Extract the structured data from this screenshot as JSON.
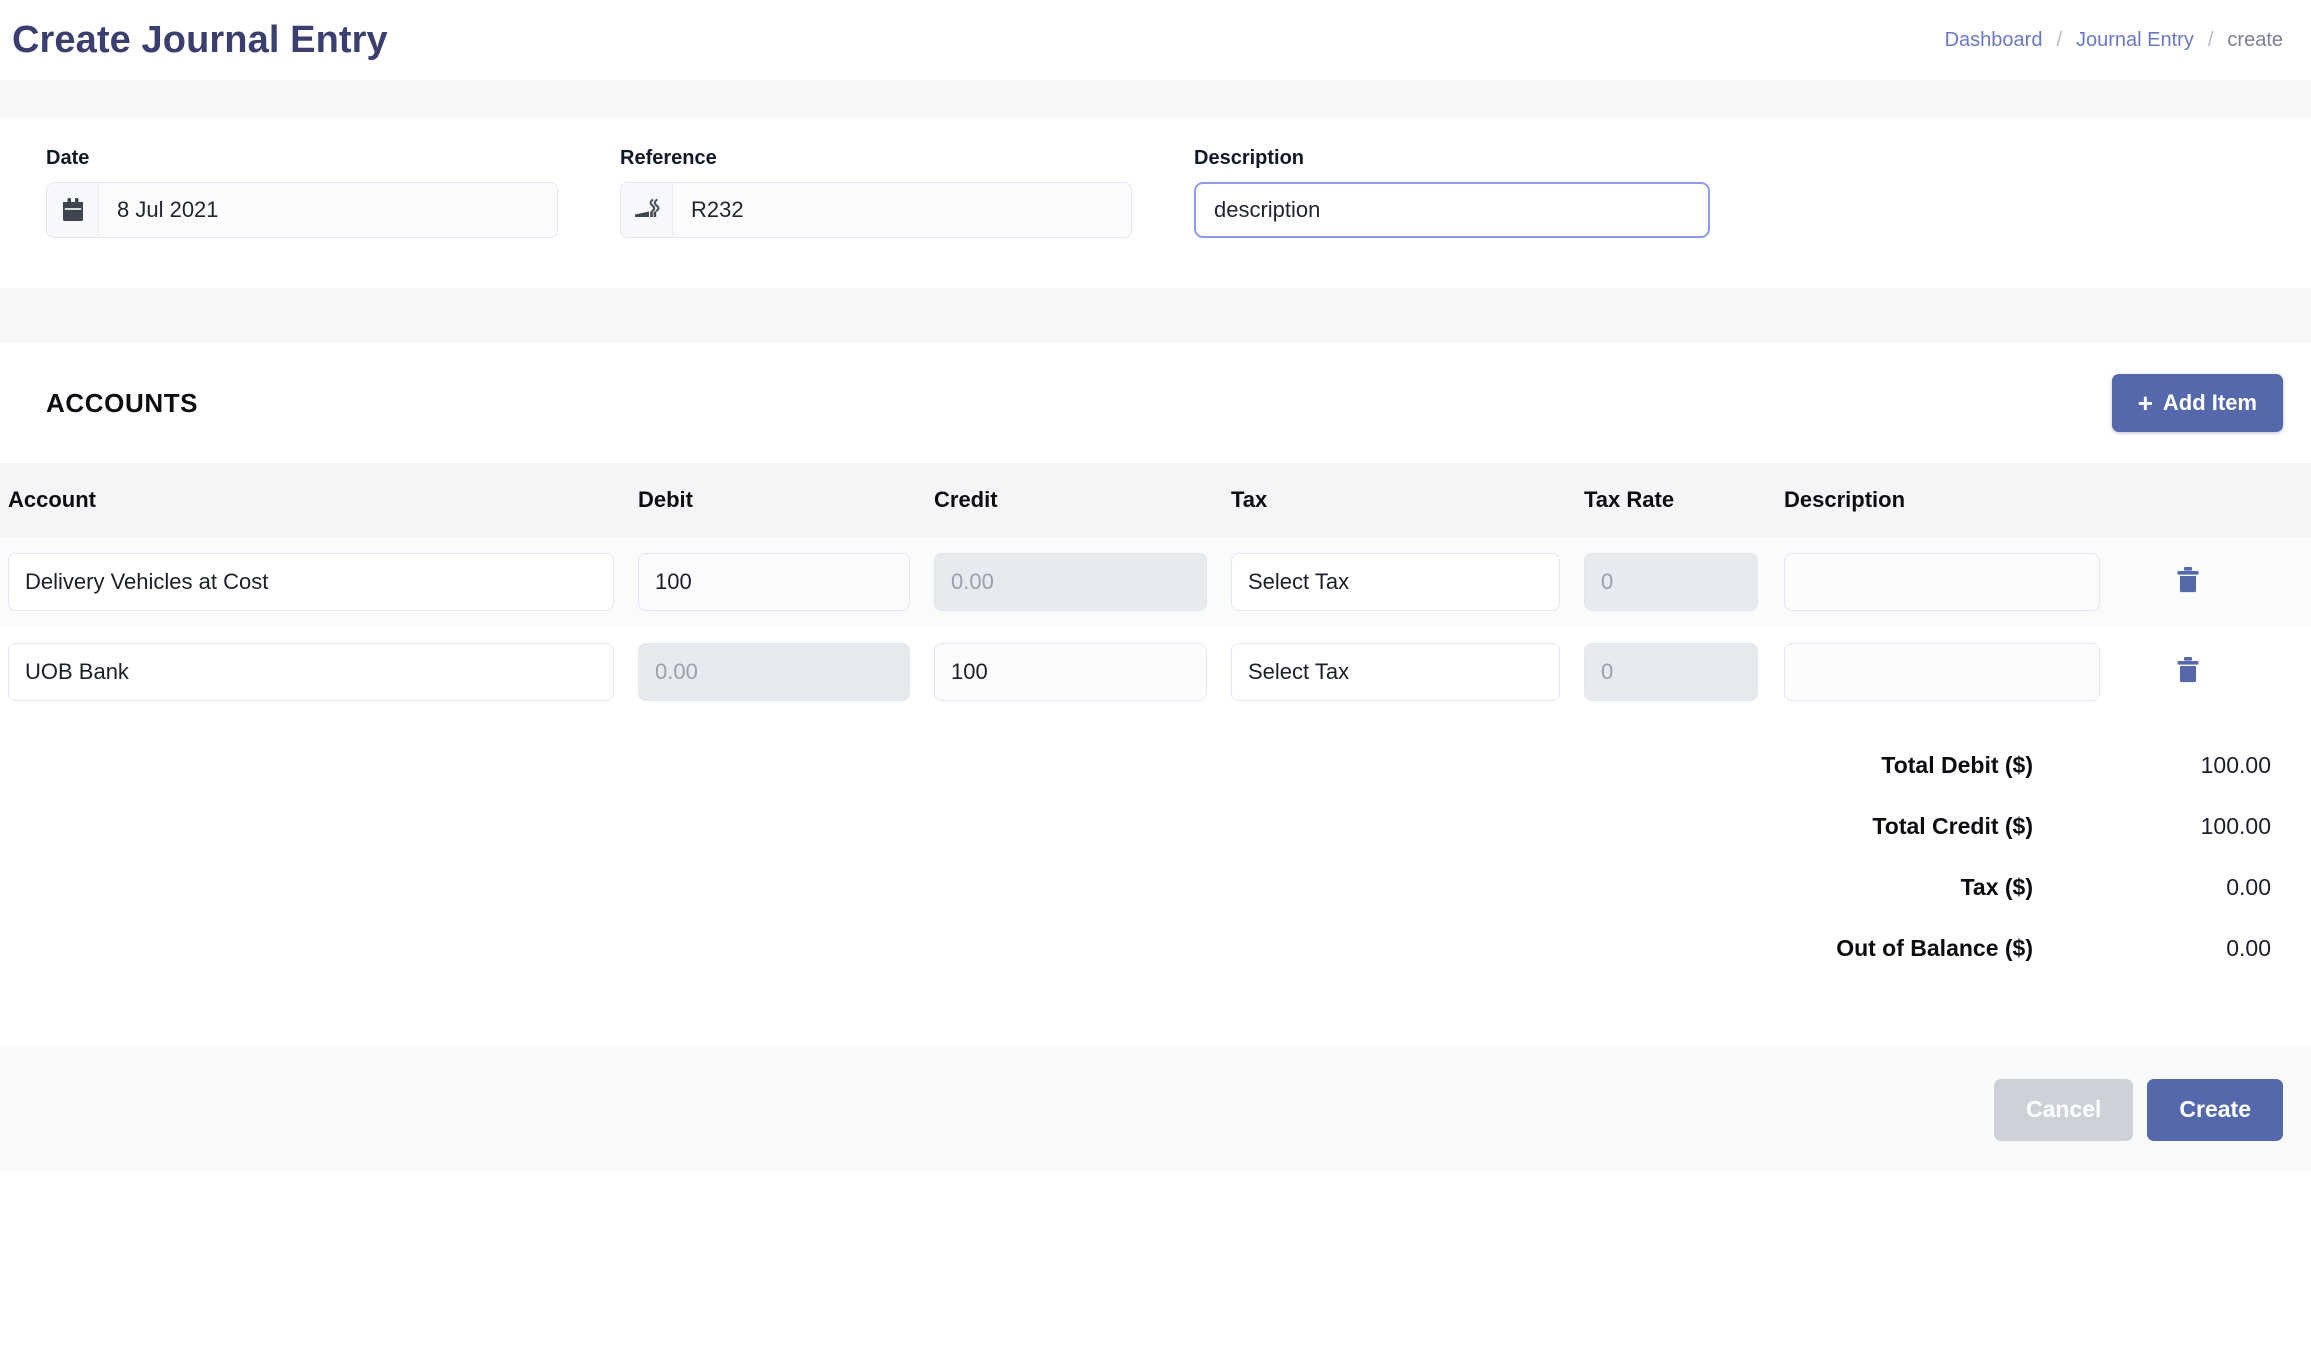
{
  "header": {
    "title": "Create Journal Entry",
    "breadcrumb": {
      "dashboard": "Dashboard",
      "sep1": "/",
      "journal_entry": "Journal Entry",
      "sep2": "/",
      "current": "create"
    }
  },
  "form": {
    "date": {
      "label": "Date",
      "icon": "calendar-icon",
      "value": "8 Jul 2021"
    },
    "reference": {
      "label": "Reference",
      "icon": "smoking-icon",
      "value": "R232"
    },
    "description": {
      "label": "Description",
      "value": "description",
      "placeholder": "description",
      "focused": true
    }
  },
  "accounts": {
    "section_title": "ACCOUNTS",
    "add_item_label": "Add Item",
    "add_item_icon": "plus-icon",
    "columns": [
      "Account",
      "Debit",
      "Credit",
      "Tax",
      "Tax Rate",
      "Description"
    ],
    "rows": [
      {
        "account": "Delivery Vehicles at Cost",
        "debit": "100",
        "debit_disabled": false,
        "credit": "0.00",
        "credit_disabled": true,
        "tax": "Select Tax",
        "tax_rate": "0",
        "tax_rate_disabled": true,
        "description": "",
        "delete_icon": "trash-icon"
      },
      {
        "account": "UOB Bank",
        "debit": "0.00",
        "debit_disabled": true,
        "credit": "100",
        "credit_disabled": false,
        "tax": "Select Tax",
        "tax_rate": "0",
        "tax_rate_disabled": true,
        "description": "",
        "delete_icon": "trash-icon"
      }
    ],
    "totals": [
      {
        "label": "Total Debit ($)",
        "value": "100.00"
      },
      {
        "label": "Total Credit ($)",
        "value": "100.00"
      },
      {
        "label": "Tax ($)",
        "value": "0.00"
      },
      {
        "label": "Out of Balance ($)",
        "value": "0.00"
      }
    ]
  },
  "footer": {
    "cancel_label": "Cancel",
    "create_label": "Create"
  },
  "colors": {
    "title": "#3b3f70",
    "accent": "#5568ab",
    "breadcrumb_link": "#6b78c8",
    "focus_border": "#8f9ae6",
    "disabled_field": "#e7eaef",
    "band": "#f6f8f9"
  }
}
